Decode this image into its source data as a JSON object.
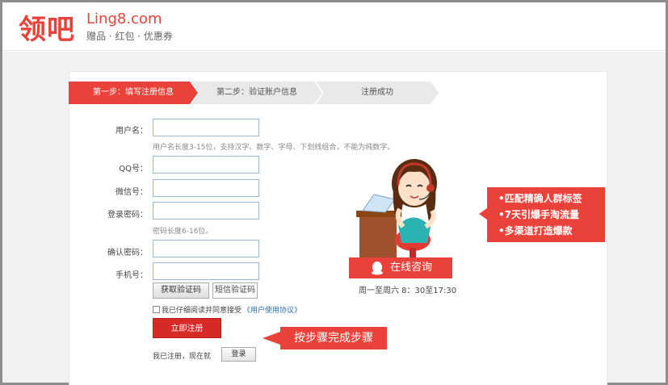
{
  "header": {
    "logo_cn": "领吧",
    "logo_en": "Ling8.com",
    "tagline": "赠品 · 红包 · 优惠券"
  },
  "steps": [
    {
      "label": "第一步：填写注册信息",
      "active": true
    },
    {
      "label": "第二步：验证账户信息",
      "active": false
    },
    {
      "label": "注册成功",
      "active": false
    }
  ],
  "form": {
    "username_label": "用户名：",
    "username_hint": "用户名长度3-15位，支持汉字、数字、字母、下划线组合，不能为纯数字。",
    "qq_label": "QQ号：",
    "wechat_label": "微信号：",
    "password_label": "登录密码：",
    "password_hint": "密码长度6-16位。",
    "confirm_label": "确认密码：",
    "phone_label": "手机号：",
    "get_code_button": "获取验证码",
    "sms_code_placeholder": "短信验证码",
    "agree_text": "我已仔细阅读并同意接受",
    "agree_link": "《用户使用协议》",
    "register_button": "立即注册",
    "already_registered": "我已注册，现在就",
    "login_button": "登录"
  },
  "callout": "按步骤完成步骤",
  "service": {
    "qq_button": "在线咨询",
    "hours": "周一至周六 8：30至17:30"
  },
  "features": [
    "•匹配精确人群标签",
    "•7天引爆手淘流量",
    "•多渠道打造爆款"
  ],
  "colors": {
    "brand": "#e8423a",
    "border": "#9bb6cf"
  }
}
